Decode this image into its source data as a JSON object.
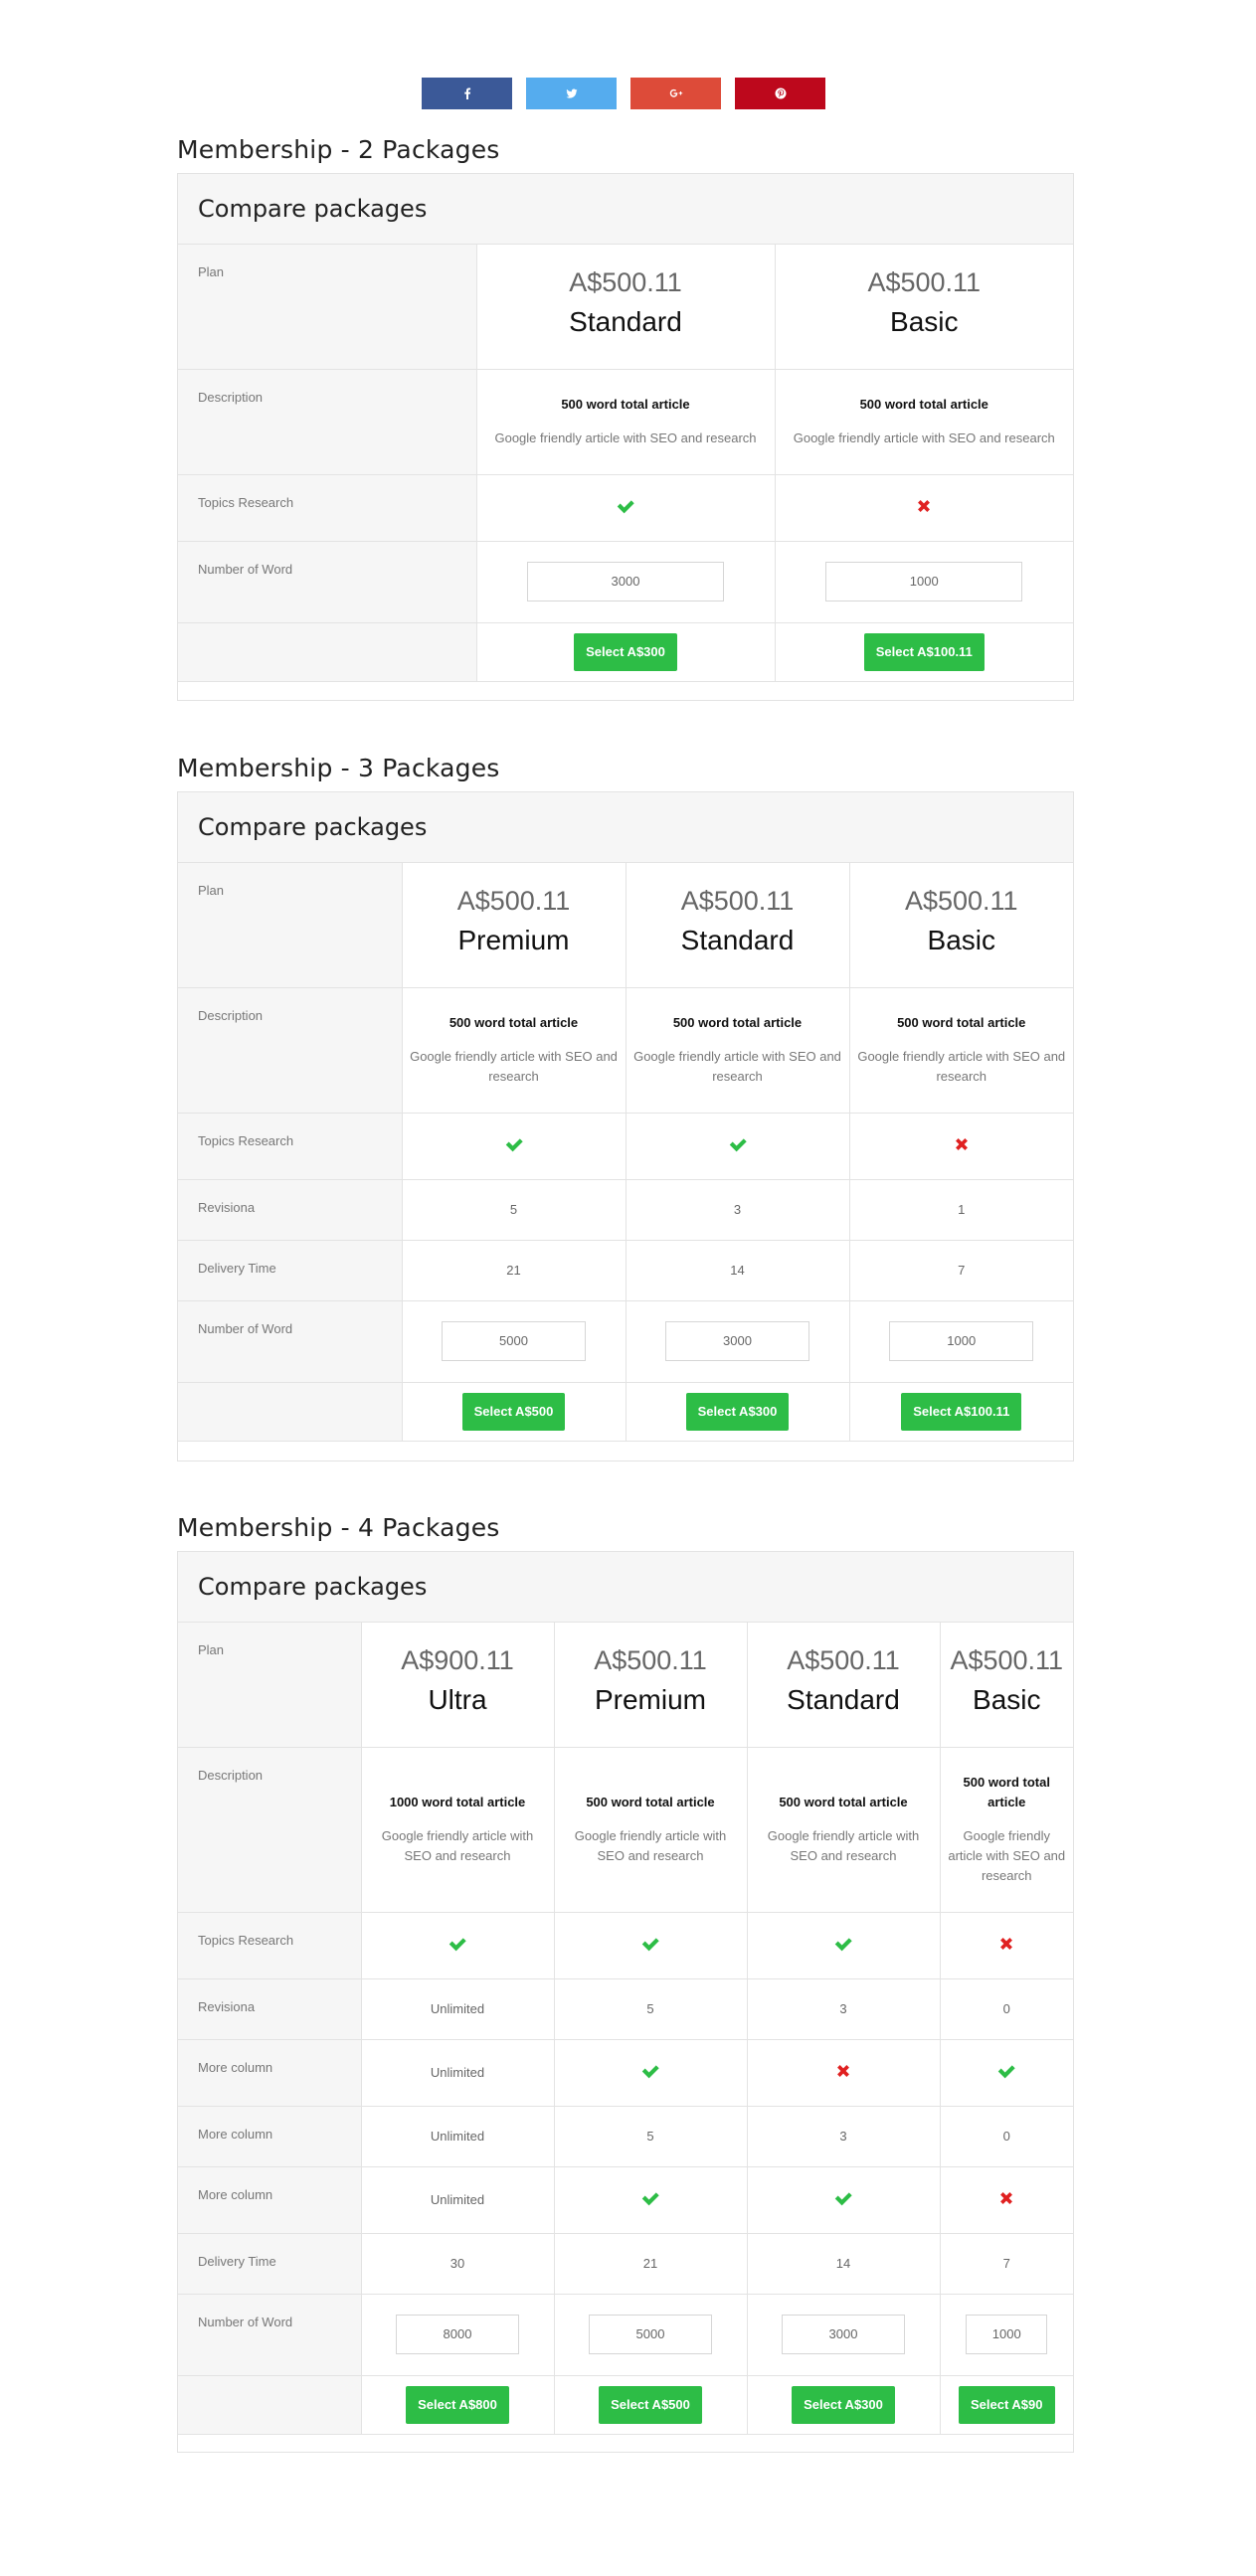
{
  "share": [
    {
      "name": "facebook",
      "glyph": "f",
      "color": "#3b5998"
    },
    {
      "name": "twitter",
      "glyph": "t",
      "color": "#55acee"
    },
    {
      "name": "google-plus",
      "glyph": "G+",
      "color": "#dd4b39"
    },
    {
      "name": "pinterest",
      "glyph": "p",
      "color": "#bd081c"
    }
  ],
  "colors": {
    "check": "#2dbd46",
    "cross": "#e02020",
    "button": "#2dbd46",
    "label_bg": "#f6f6f6"
  },
  "sections": [
    {
      "title": "Membership - 2 Packages",
      "box_title": "Compare packages",
      "labels": {
        "plan": "Plan",
        "description": "Description",
        "topics": "Topics Research",
        "words": "Number of Word"
      },
      "plans": [
        {
          "price": "A$500.11",
          "name": "Standard",
          "desc_title": "500 word total article",
          "desc_text": "Google friendly article with SEO and research",
          "topics": "check",
          "words": "3000",
          "button": "Select A$300"
        },
        {
          "price": "A$500.11",
          "name": "Basic",
          "desc_title": "500 word total article",
          "desc_text": "Google friendly article with SEO and research",
          "topics": "cross",
          "words": "1000",
          "button": "Select A$100.11"
        }
      ]
    },
    {
      "title": "Membership - 3 Packages",
      "box_title": "Compare packages",
      "labels": {
        "plan": "Plan",
        "description": "Description",
        "topics": "Topics Research",
        "revisions": "Revisiona",
        "delivery": "Delivery Time",
        "words": "Number of Word"
      },
      "plans": [
        {
          "price": "A$500.11",
          "name": "Premium",
          "desc_title": "500 word total article",
          "desc_text": "Google friendly article with SEO and research",
          "topics": "check",
          "revisions": "5",
          "delivery": "21",
          "words": "5000",
          "button": "Select A$500"
        },
        {
          "price": "A$500.11",
          "name": "Standard",
          "desc_title": "500 word total article",
          "desc_text": "Google friendly article with SEO and research",
          "topics": "check",
          "revisions": "3",
          "delivery": "14",
          "words": "3000",
          "button": "Select A$300"
        },
        {
          "price": "A$500.11",
          "name": "Basic",
          "desc_title": "500 word total article",
          "desc_text": "Google friendly article with SEO and research",
          "topics": "cross",
          "revisions": "1",
          "delivery": "7",
          "words": "1000",
          "button": "Select A$100.11"
        }
      ]
    },
    {
      "title": "Membership - 4 Packages",
      "box_title": "Compare packages",
      "labels": {
        "plan": "Plan",
        "description": "Description",
        "topics": "Topics Research",
        "revisions": "Revisiona",
        "more1": "More column",
        "more2": "More column",
        "more3": "More column",
        "delivery": "Delivery Time",
        "words": "Number of Word"
      },
      "plans": [
        {
          "price": "A$900.11",
          "name": "Ultra",
          "desc_title": "1000 word total article",
          "desc_text": "Google friendly article with SEO and research",
          "topics": "check",
          "revisions": "Unlimited",
          "more1": "Unlimited",
          "more2": "Unlimited",
          "more3": "Unlimited",
          "delivery": "30",
          "words": "8000",
          "button": "Select A$800"
        },
        {
          "price": "A$500.11",
          "name": "Premium",
          "desc_title": "500 word total article",
          "desc_text": "Google friendly article with SEO and research",
          "topics": "check",
          "revisions": "5",
          "more1": "check",
          "more2": "5",
          "more3": "check",
          "delivery": "21",
          "words": "5000",
          "button": "Select A$500"
        },
        {
          "price": "A$500.11",
          "name": "Standard",
          "desc_title": "500 word total article",
          "desc_text": "Google friendly article with SEO and research",
          "topics": "check",
          "revisions": "3",
          "more1": "cross",
          "more2": "3",
          "more3": "check",
          "delivery": "14",
          "words": "3000",
          "button": "Select A$300"
        },
        {
          "price": "A$500.11",
          "name": "Basic",
          "desc_title": "500 word total article",
          "desc_text": "Google friendly article with SEO and research",
          "topics": "cross",
          "revisions": "0",
          "more1": "check",
          "more2": "0",
          "more3": "cross",
          "delivery": "7",
          "words": "1000",
          "button": "Select A$90"
        }
      ]
    }
  ]
}
